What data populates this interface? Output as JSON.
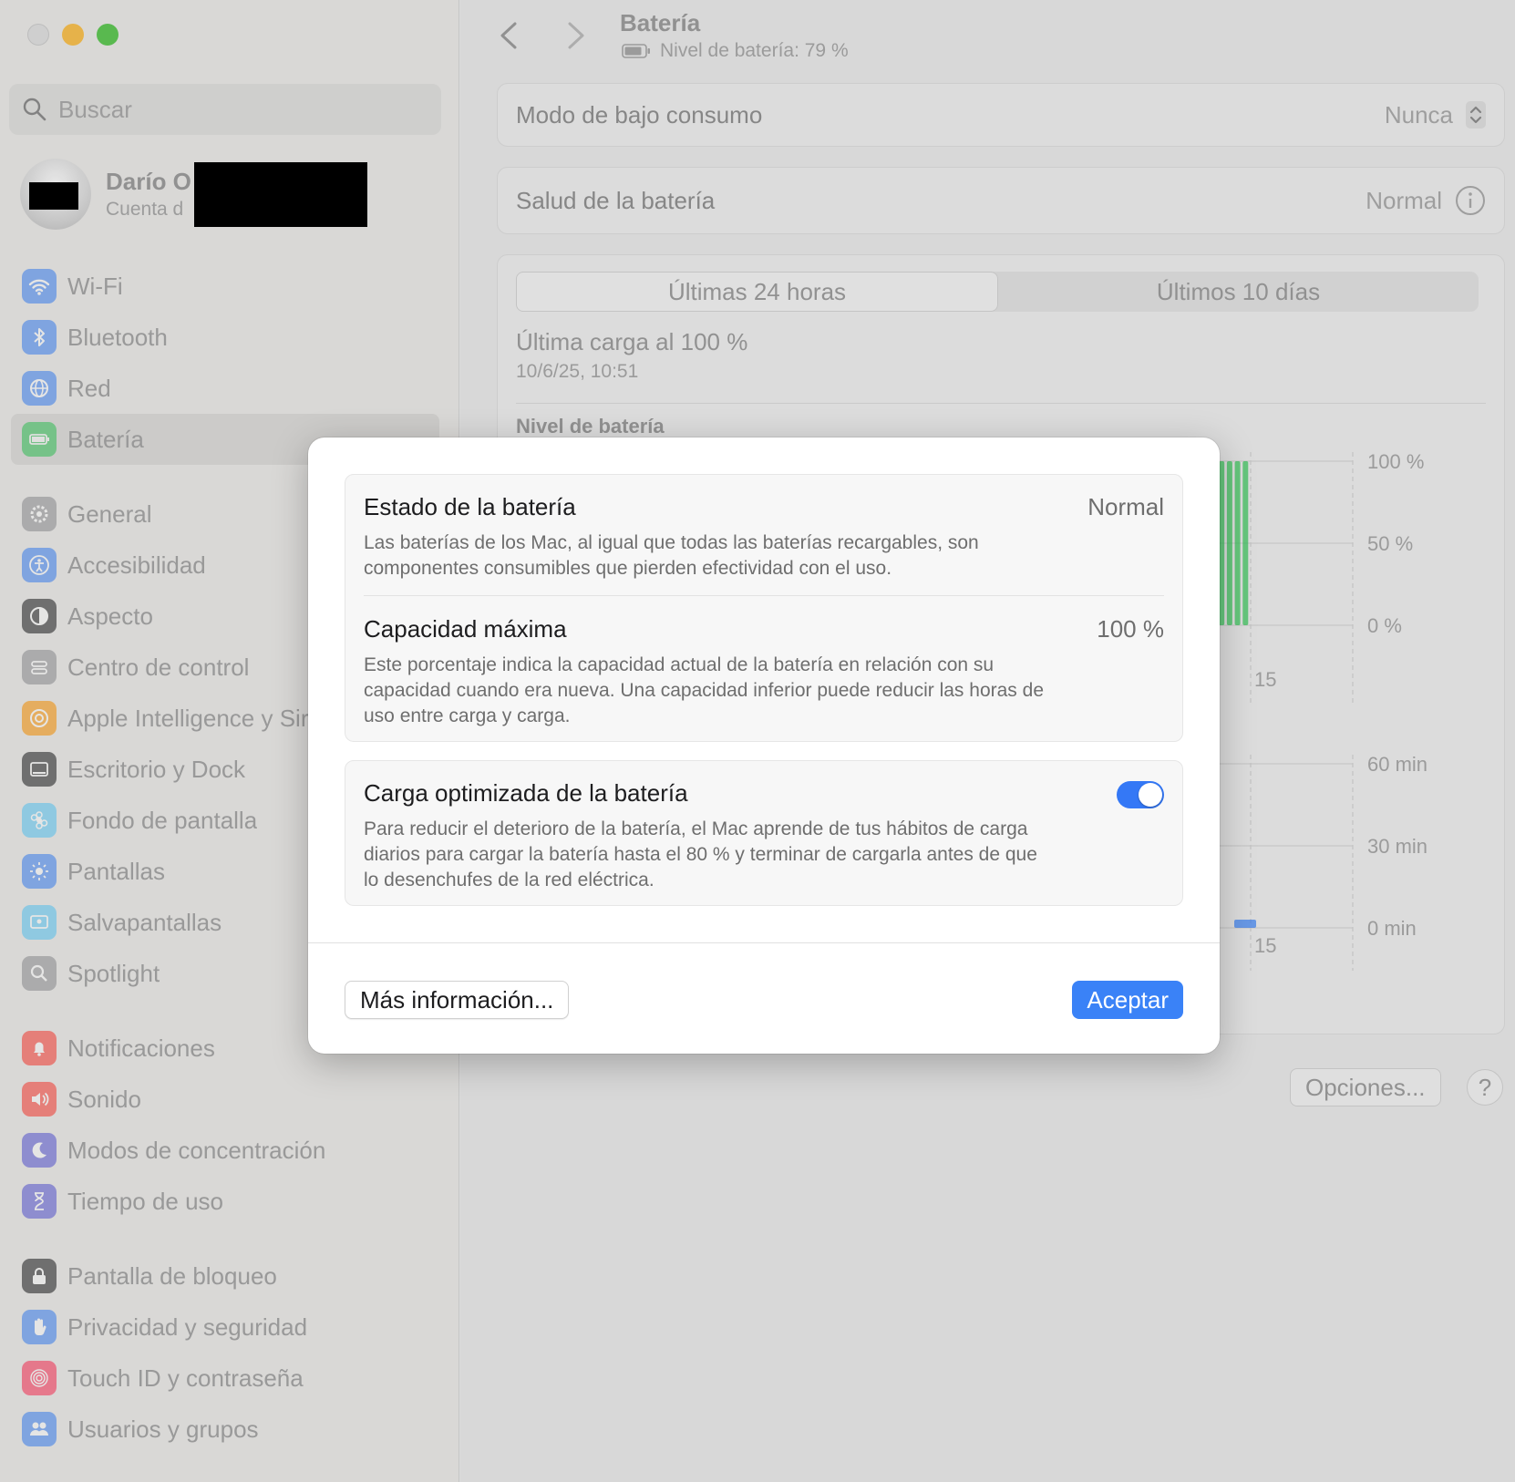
{
  "window": {
    "title": "Batería",
    "battery_level": "Nivel de batería: 79 %"
  },
  "search": {
    "placeholder": "Buscar"
  },
  "account": {
    "name": "Darío O",
    "subtitle": "Cuenta d"
  },
  "sidebar": {
    "items": [
      {
        "label": "Wi-Fi",
        "icon": "wifi-icon",
        "color": "#3b82f6"
      },
      {
        "label": "Bluetooth",
        "icon": "bluetooth-icon",
        "color": "#3b82f6"
      },
      {
        "label": "Red",
        "icon": "globe-icon",
        "color": "#3b82f6"
      },
      {
        "label": "Batería",
        "icon": "battery-icon",
        "color": "#34c759"
      },
      {
        "label": "General",
        "icon": "gear-icon",
        "color": "#8e8e93"
      },
      {
        "label": "Accesibilidad",
        "icon": "accessibility-icon",
        "color": "#3b82f6"
      },
      {
        "label": "Aspecto",
        "icon": "appearance-icon",
        "color": "#1c1c1e"
      },
      {
        "label": "Centro de control",
        "icon": "control-center-icon",
        "color": "#8e8e93"
      },
      {
        "label": "Apple Intelligence y Siri",
        "icon": "siri-icon",
        "color": "#ff9500"
      },
      {
        "label": "Escritorio y Dock",
        "icon": "dock-icon",
        "color": "#1c1c1e"
      },
      {
        "label": "Fondo de pantalla",
        "icon": "wallpaper-icon",
        "color": "#5ac8fa"
      },
      {
        "label": "Pantallas",
        "icon": "display-icon",
        "color": "#3b82f6"
      },
      {
        "label": "Salvapantallas",
        "icon": "screensaver-icon",
        "color": "#5ac8fa"
      },
      {
        "label": "Spotlight",
        "icon": "spotlight-icon",
        "color": "#8e8e93"
      },
      {
        "label": "Notificaciones",
        "icon": "bell-icon",
        "color": "#ff3b30"
      },
      {
        "label": "Sonido",
        "icon": "speaker-icon",
        "color": "#ff3b30"
      },
      {
        "label": "Modos de concentración",
        "icon": "moon-icon",
        "color": "#5856d6"
      },
      {
        "label": "Tiempo de uso",
        "icon": "hourglass-icon",
        "color": "#5856d6"
      },
      {
        "label": "Pantalla de bloqueo",
        "icon": "lock-icon",
        "color": "#1c1c1e"
      },
      {
        "label": "Privacidad y seguridad",
        "icon": "hand-icon",
        "color": "#3b82f6"
      },
      {
        "label": "Touch ID y contraseña",
        "icon": "fingerprint-icon",
        "color": "#ff2d55"
      },
      {
        "label": "Usuarios y grupos",
        "icon": "users-icon",
        "color": "#3b82f6"
      }
    ]
  },
  "main": {
    "low_power": {
      "label": "Modo de bajo consumo",
      "value": "Nunca"
    },
    "health": {
      "label": "Salud de la batería",
      "value": "Normal"
    },
    "tabs": [
      "Últimas 24 horas",
      "Últimos 10 días"
    ],
    "last_charge": {
      "label": "Última carga al 100 %",
      "date": "10/6/25, 10:51"
    },
    "chart_title": "Nivel de batería",
    "options_button": "Opciones...",
    "help_button": "?"
  },
  "chart_data": [
    {
      "type": "bar",
      "title": "Nivel de batería",
      "y_ticks": [
        "100 %",
        "50 %",
        "0 %"
      ],
      "x_tick": "15",
      "ylim": [
        0,
        100
      ],
      "values": [
        100,
        100,
        100,
        100,
        100,
        100,
        100,
        100,
        100,
        100
      ],
      "color": "#34c759"
    },
    {
      "type": "bar",
      "y_ticks": [
        "60 min",
        "30 min",
        "0 min"
      ],
      "x_tick": "15",
      "ylim": [
        0,
        60
      ],
      "values": [
        3
      ],
      "color": "#3b82f6"
    }
  ],
  "dialog": {
    "status": {
      "title": "Estado de la batería",
      "value": "Normal",
      "description": "Las baterías de los Mac, al igual que todas las baterías recargables, son componentes consumibles que pierden efectividad con el uso."
    },
    "capacity": {
      "title": "Capacidad máxima",
      "value": "100 %",
      "description": "Este porcentaje indica la capacidad actual de la batería en relación con su capacidad cuando era nueva. Una capacidad inferior puede reducir las horas de uso entre carga y carga."
    },
    "optimized": {
      "title": "Carga optimizada de la batería",
      "enabled": true,
      "description": "Para reducir el deterioro de la batería, el Mac aprende de tus hábitos de carga diarios para cargar la batería hasta el 80 % y terminar de cargarla antes de que lo desenchufes de la red eléctrica."
    },
    "more_button": "Más información...",
    "ok_button": "Aceptar",
    "accent": "#3a82f7"
  }
}
